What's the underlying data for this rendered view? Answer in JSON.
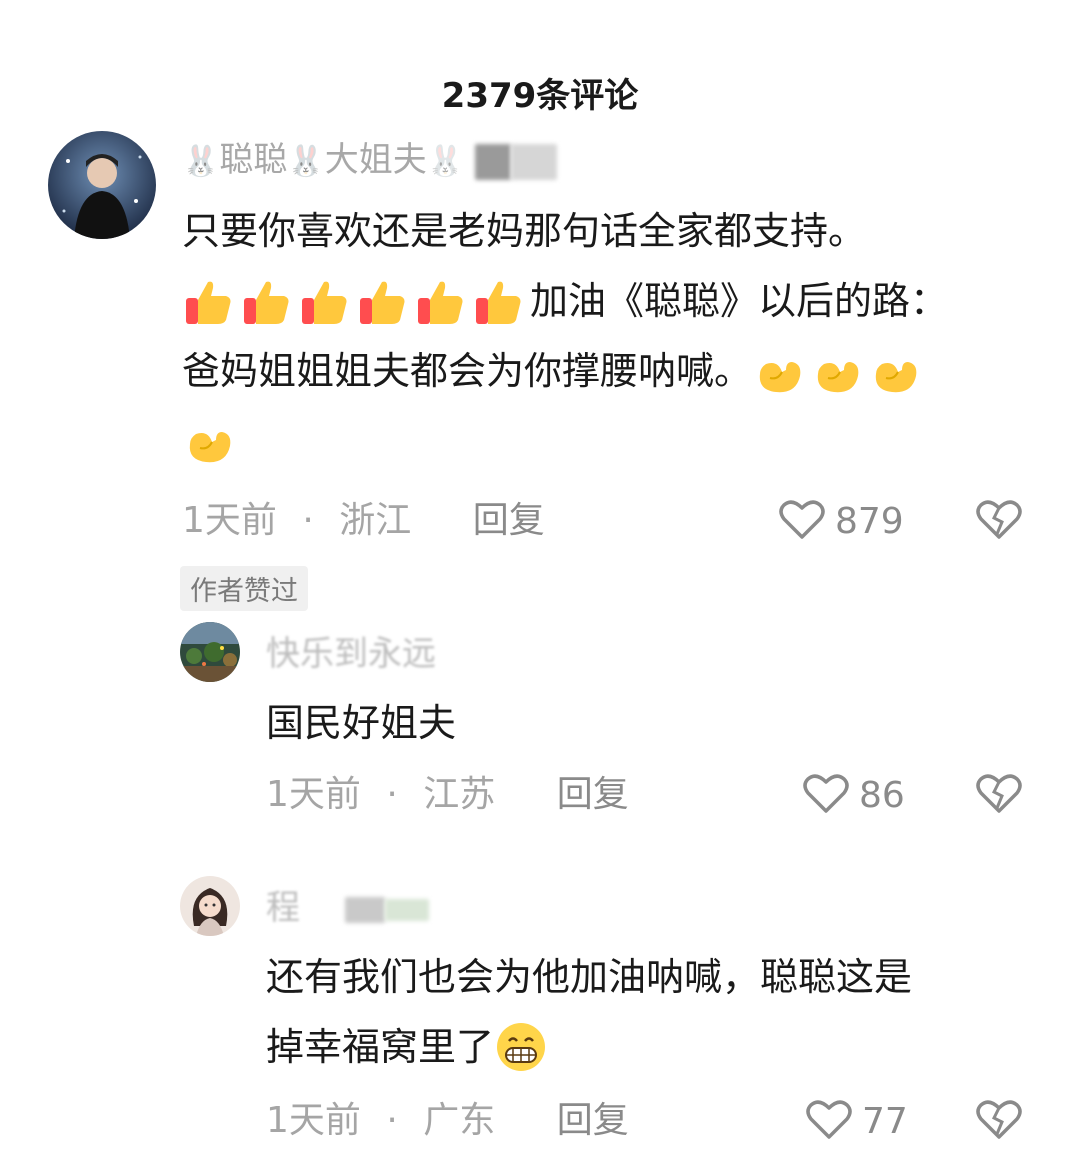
{
  "header": {
    "title": "2379条评论"
  },
  "comments": [
    {
      "user": {
        "name_a": "聪聪",
        "name_b": "大姐夫"
      },
      "line1": "只要你喜欢还是老妈那句话全家都支持。",
      "line2_text": "加油《聪聪》以后的路：",
      "line3": "爸妈姐姐姐夫都会为你撑腰呐喊。",
      "time": "1天前",
      "dot": "·",
      "location": "浙江",
      "reply_label": "回复",
      "likes": "879",
      "badge": "作者赞过",
      "emoji": {
        "thumbs": "thumbs-up-icon",
        "muscle": "flexed-biceps-icon"
      }
    },
    {
      "user": {
        "name": "快乐到永远"
      },
      "text": "国民好姐夫",
      "time": "1天前",
      "dot": "·",
      "location": "江苏",
      "reply_label": "回复",
      "likes": "86"
    },
    {
      "user": {
        "name": "程"
      },
      "line1": "还有我们也会为他加油呐喊，聪聪这是",
      "line2": "掉幸福窝里了",
      "time": "1天前",
      "dot": "·",
      "location": "广东",
      "reply_label": "回复",
      "likes": "77",
      "emoji": "grinning-face-icon"
    }
  ]
}
